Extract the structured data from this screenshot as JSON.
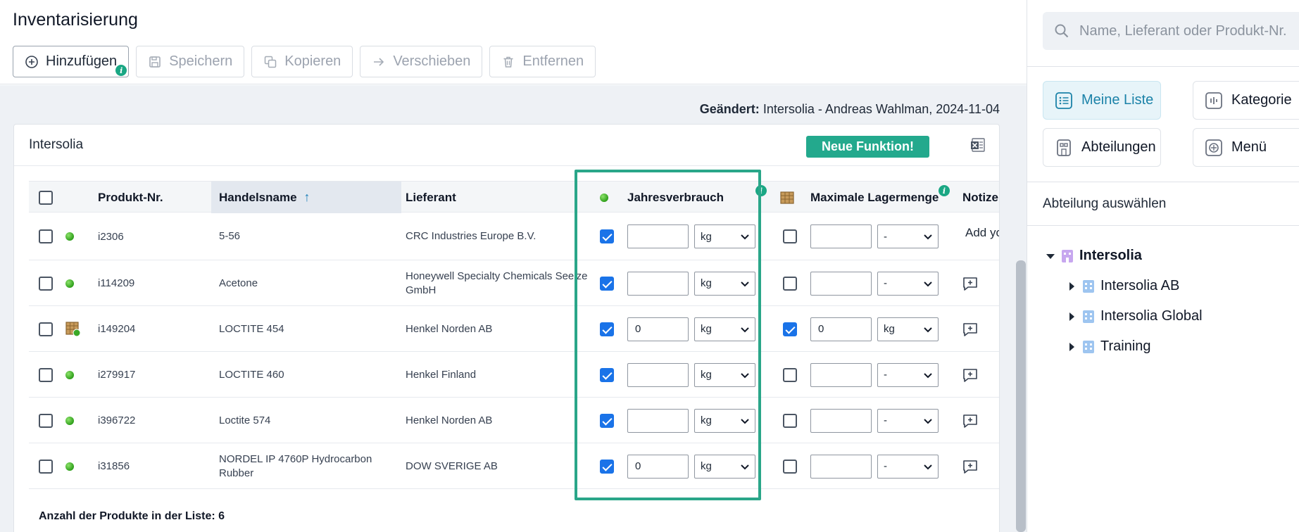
{
  "page": {
    "title": "Inventarisierung"
  },
  "toolbar": {
    "add": "Hinzufügen",
    "add_info": "i",
    "save": "Speichern",
    "copy": "Kopieren",
    "move": "Verschieben",
    "remove": "Entfernen"
  },
  "changed": {
    "label": "Geändert:",
    "value": " Intersolia - Andreas Wahlman, 2024-11-04"
  },
  "card": {
    "title": "Intersolia",
    "new_feature": "Neue Funktion!"
  },
  "table": {
    "headers": {
      "product_no": "Produkt-Nr.",
      "trade_name": "Handelsname",
      "supplier": "Lieferant",
      "annual_use": "Jahresverbrauch",
      "max_storage": "Maximale Lagermenge",
      "notes": "Notizen",
      "info": "i"
    },
    "rows": [
      {
        "product_no": "i2306",
        "trade_name": "5-56",
        "supplier": "CRC Industries Europe B.V.",
        "status": "green",
        "annual_checked": true,
        "annual_value": "",
        "annual_unit": "kg",
        "storage_checked": false,
        "storage_value": "",
        "storage_unit": "-",
        "note": "Add your"
      },
      {
        "product_no": "i114209",
        "trade_name": "Acetone",
        "supplier": "Honeywell Specialty Chemicals Seelze GmbH",
        "status": "green",
        "annual_checked": true,
        "annual_value": "",
        "annual_unit": "kg",
        "storage_checked": false,
        "storage_value": "",
        "storage_unit": "-",
        "note": ""
      },
      {
        "product_no": "i149204",
        "trade_name": "LOCTITE 454",
        "supplier": "Henkel Norden AB",
        "status": "box-green",
        "annual_checked": true,
        "annual_value": "0",
        "annual_unit": "kg",
        "storage_checked": true,
        "storage_value": "0",
        "storage_unit": "kg",
        "note": ""
      },
      {
        "product_no": "i279917",
        "trade_name": "LOCTITE 460",
        "supplier": "Henkel Finland",
        "status": "green",
        "annual_checked": true,
        "annual_value": "",
        "annual_unit": "kg",
        "storage_checked": false,
        "storage_value": "",
        "storage_unit": "-",
        "note": ""
      },
      {
        "product_no": "i396722",
        "trade_name": "Loctite 574",
        "supplier": "Henkel Norden AB",
        "status": "green",
        "annual_checked": true,
        "annual_value": "",
        "annual_unit": "kg",
        "storage_checked": false,
        "storage_value": "",
        "storage_unit": "-",
        "note": ""
      },
      {
        "product_no": "i31856",
        "trade_name": "NORDEL IP 4760P Hydrocarbon Rubber",
        "supplier": "DOW SVERIGE AB",
        "status": "green",
        "annual_checked": true,
        "annual_value": "0",
        "annual_unit": "kg",
        "storage_checked": false,
        "storage_value": "",
        "storage_unit": "-",
        "note": ""
      }
    ],
    "footer": "Anzahl der Produkte in der Liste: 6"
  },
  "side": {
    "search_placeholder": "Name, Lieferant oder Produkt-Nr.",
    "views": {
      "my_list": "Meine Liste",
      "category": "Kategorie",
      "departments": "Abteilungen",
      "menu": "Menü"
    },
    "dept_label": "Abteilung auswählen",
    "tree": {
      "root": "Intersolia",
      "children": [
        "Intersolia AB",
        "Intersolia Global",
        "Training"
      ]
    }
  },
  "colors": {
    "accent_teal": "#23a98d",
    "active_blue": "#1b82a8",
    "checkbox_blue": "#1a73e8"
  }
}
